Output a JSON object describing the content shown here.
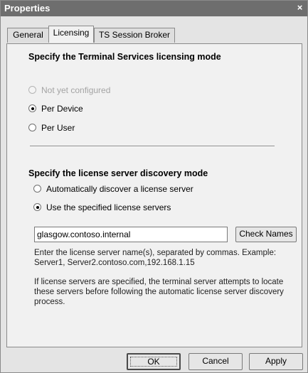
{
  "window": {
    "title": "Properties",
    "close_glyph": "×"
  },
  "tabs": [
    {
      "label": "General",
      "active": false
    },
    {
      "label": "Licensing",
      "active": true
    },
    {
      "label": "TS Session Broker",
      "active": false
    }
  ],
  "licensing_mode": {
    "heading": "Specify the Terminal Services licensing mode",
    "options": [
      {
        "label": "Not yet configured",
        "selected": false,
        "enabled": false
      },
      {
        "label": "Per Device",
        "selected": true,
        "enabled": true
      },
      {
        "label": "Per User",
        "selected": false,
        "enabled": true
      }
    ]
  },
  "discovery_mode": {
    "heading": "Specify the license server discovery mode",
    "options": [
      {
        "label": "Automatically discover a license server",
        "selected": false,
        "enabled": true
      },
      {
        "label": "Use the specified license servers",
        "selected": true,
        "enabled": true
      }
    ],
    "server_input_value": "glasgow.contoso.internal",
    "check_names_label": "Check Names",
    "help_text_1": "Enter the license server name(s), separated by commas. Example: Server1, Server2.contoso.com,192.168.1.15",
    "help_text_2": "If license servers are specified, the terminal server attempts to locate these servers before following the automatic license server discovery process."
  },
  "footer": {
    "ok_label": "OK",
    "cancel_label": "Cancel",
    "apply_label": "Apply"
  }
}
